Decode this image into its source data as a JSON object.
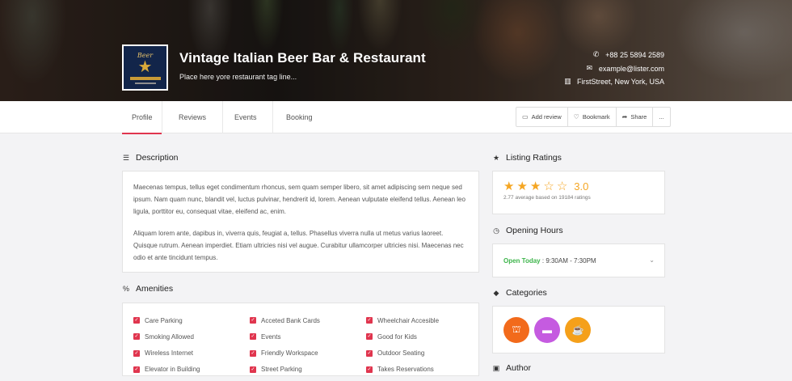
{
  "hero": {
    "title": "Vintage Italian Beer Bar & Restaurant",
    "tagline": "Place here yore restaurant tag line...",
    "logo_text": "Beer",
    "phone": "+88 25 5894 2589",
    "email": "example@lister.com",
    "address": "FirstStreet, New York, USA"
  },
  "tabs": [
    {
      "label": "Profile",
      "active": true
    },
    {
      "label": "Reviews",
      "active": false
    },
    {
      "label": "Events",
      "active": false
    },
    {
      "label": "Booking",
      "active": false
    }
  ],
  "actions": {
    "add_review": "Add review",
    "bookmark": "Bookmark",
    "share": "Share",
    "more": "..."
  },
  "description": {
    "heading": "Description",
    "paragraphs": [
      "Maecenas tempus, tellus eget condimentum rhoncus, sem quam semper libero, sit amet adipiscing sem neque sed ipsum. Nam quam nunc, blandit vel, luctus pulvinar, hendrerit id, lorem. Aenean vulputate eleifend tellus. Aenean leo ligula, porttitor eu, consequat vitae, eleifend ac, enim.",
      "Aliquam lorem ante, dapibus in, viverra quis, feugiat a, tellus. Phasellus viverra nulla ut metus varius laoreet. Quisque rutrum. Aenean imperdiet. Etiam ultricies nisi vel augue. Curabitur ullamcorper ultricies nisi. Maecenas nec odio et ante tincidunt tempus."
    ]
  },
  "amenities": {
    "heading": "Amenities",
    "items": [
      "Care Parking",
      "Acceted Bank Cards",
      "Wheelchair Accesible",
      "Smoking Allowed",
      "Events",
      "Good for Kids",
      "Wireless Internet",
      "Friendly Workspace",
      "Outdoor Seating",
      "Elevator in Building",
      "Street Parking",
      "Takes Reservations"
    ]
  },
  "ratings": {
    "heading": "Listing Ratings",
    "value": "3.0",
    "stars_filled": 3,
    "stars_total": 5,
    "subtext": "2.77 average based on 19184 ratings"
  },
  "hours": {
    "heading": "Opening Hours",
    "status": "Open Today",
    "separator": " : ",
    "time": "9:30AM - 7:30PM"
  },
  "categories": {
    "heading": "Categories",
    "items": [
      {
        "icon": "food-icon",
        "color": "#f26a1b"
      },
      {
        "icon": "bed-icon",
        "color": "#c55be0"
      },
      {
        "icon": "coffee-icon",
        "color": "#f5a01a"
      }
    ]
  },
  "author": {
    "heading": "Author"
  },
  "colors": {
    "accent": "#e0354e",
    "star": "#f5a623",
    "open": "#3cb44a"
  }
}
